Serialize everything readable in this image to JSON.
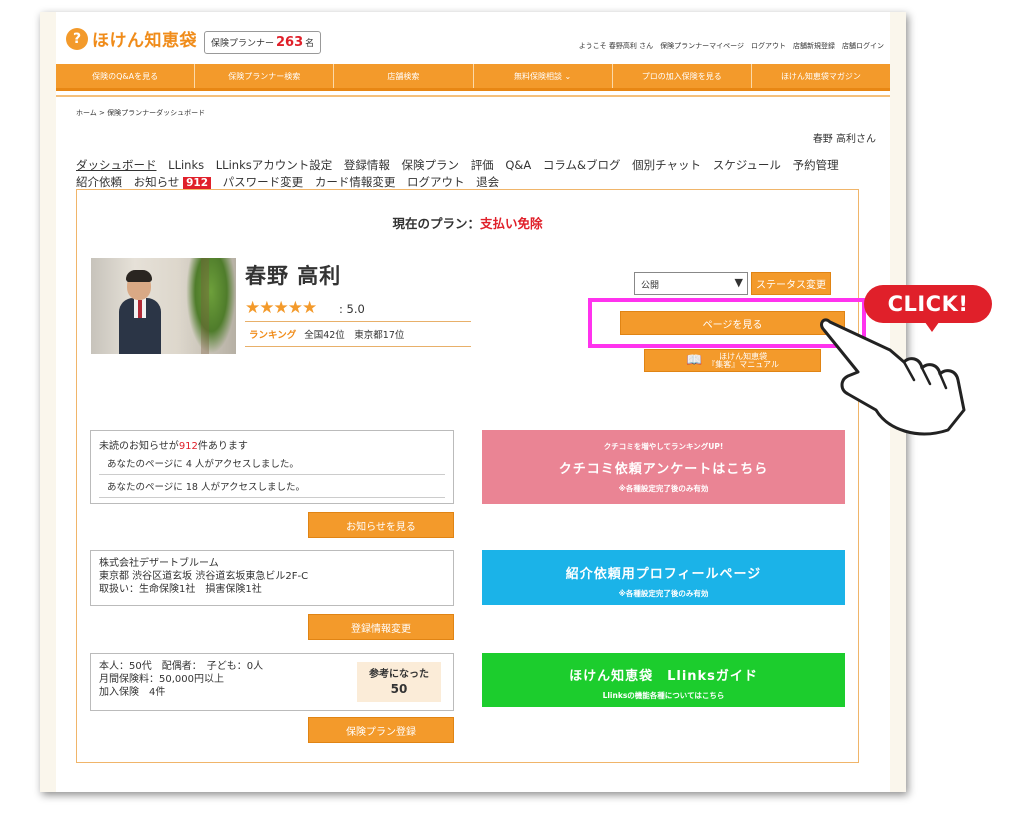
{
  "header": {
    "logo_text": "ほけん知恵袋",
    "planner_label": "保険プランナー",
    "planner_count": "263",
    "planner_unit": "名",
    "top_links": "ようこそ 春野高利 さん　保険プランナーマイページ　ログアウト　店舗新規登録　店舗ログイン"
  },
  "nav": {
    "items": [
      "保険のQ&Aを見る",
      "保険プランナー検索",
      "店舗検索",
      "無料保険相談 ⌄",
      "プロの加入保険を見る",
      "ほけん知恵袋マガジン"
    ]
  },
  "breadcrumb": "ホーム > 保険プランナーダッシュボード",
  "user_name": "春野 高利さん",
  "tabs": {
    "dashboard": "ダッシュボード",
    "llinks": "LLinks",
    "llinks_account": "LLinksアカウント設定",
    "registration": "登録情報",
    "insurance_plan": "保険プラン",
    "review": "評価",
    "qa": "Q&A",
    "column": "コラム&ブログ",
    "chat": "個別チャット",
    "schedule": "スケジュール",
    "reservation": "予約管理",
    "referral": "紹介依頼",
    "notice": "お知らせ",
    "notice_count": "912",
    "password": "パスワード変更",
    "card": "カード情報変更",
    "logout": "ログアウト",
    "withdraw": "退会"
  },
  "plan": {
    "label": "現在のプラン：",
    "value": "支払い免除"
  },
  "profile": {
    "name": "春野 高利",
    "stars": "★★★★★",
    "rating": ": 5.0",
    "rank_label": "ランキング",
    "rank_value": "全国42位　東京都17位"
  },
  "status": {
    "select_value": "公開",
    "arrow": "▼",
    "change_button": "ステータス変更"
  },
  "buttons": {
    "view_page": "ページを見る",
    "manual_line1": "ほけん知恵袋",
    "manual_line2": "『集客』マニュアル",
    "view_notices": "お知らせを見る",
    "edit_registration": "登録情報変更",
    "register_plan": "保険プラン登録"
  },
  "notices": {
    "heading_pre": "未読のお知らせが",
    "heading_count": "912",
    "heading_post": "件あります",
    "items": [
      "あなたのページに 4 人がアクセスしました。",
      "あなたのページに 18 人がアクセスしました。"
    ]
  },
  "company": {
    "name": "株式会社デザートブルーム",
    "address": "東京都 渋谷区道玄坂 渋谷道玄坂東急ビル2F-C",
    "handling": "取扱い：生命保険1社　損害保険1社"
  },
  "family": {
    "line1": "本人：50代　配偶者：　子ども：0人",
    "line2": "月間保険料：50,000円以上",
    "line3": "加入保険　4件",
    "helpful_label": "参考になった",
    "helpful_count": "50"
  },
  "banners": {
    "pink_small": "クチコミを増やしてランキングUP!",
    "pink_big": "クチコミ依頼アンケートはこちら",
    "pink_note": "※各種設定完了後のみ有効",
    "blue_big": "紹介依頼用プロフィールページ",
    "blue_note": "※各種設定完了後のみ有効",
    "green_big": "ほけん知恵袋　Llinksガイド",
    "green_note": "Llinksの機能各種についてはこちら"
  },
  "callout": {
    "text": "CLICK!"
  },
  "colors": {
    "accent": "#f39a2b",
    "highlight": "#ff33ee",
    "alert": "#e0202a"
  }
}
